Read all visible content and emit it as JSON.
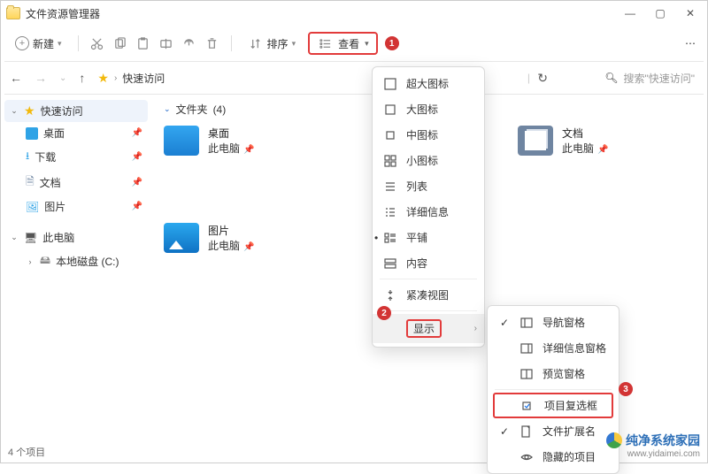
{
  "title": "文件资源管理器",
  "toolbar": {
    "new": "新建",
    "sort": "排序",
    "view": "查看"
  },
  "breadcrumb": "快速访问",
  "search_placeholder": "搜索\"快速访问\"",
  "tree": {
    "quick": "快速访问",
    "desktop": "桌面",
    "downloads": "下载",
    "docs": "文档",
    "pics": "图片",
    "pc": "此电脑",
    "drive": "本地磁盘 (C:)"
  },
  "group": {
    "header": "文件夹",
    "count": "(4)"
  },
  "items": {
    "desktop": {
      "name": "桌面",
      "sub": "此电脑"
    },
    "pics": {
      "name": "图片",
      "sub": "此电脑"
    },
    "docs": {
      "name": "文档",
      "sub": "此电脑"
    }
  },
  "viewmenu": {
    "xl": "超大图标",
    "l": "大图标",
    "m": "中图标",
    "s": "小图标",
    "list": "列表",
    "details": "详细信息",
    "tiles": "平铺",
    "content": "内容",
    "compact": "紧凑视图",
    "show": "显示"
  },
  "showmenu": {
    "nav": "导航窗格",
    "detpane": "详细信息窗格",
    "preview": "预览窗格",
    "checkboxes": "项目复选框",
    "ext": "文件扩展名",
    "hidden": "隐藏的项目"
  },
  "status": "4 个项目",
  "watermark": {
    "brand": "纯净系统家园",
    "url": "www.yidaimei.com"
  },
  "badges": {
    "b1": "1",
    "b2": "2",
    "b3": "3"
  }
}
